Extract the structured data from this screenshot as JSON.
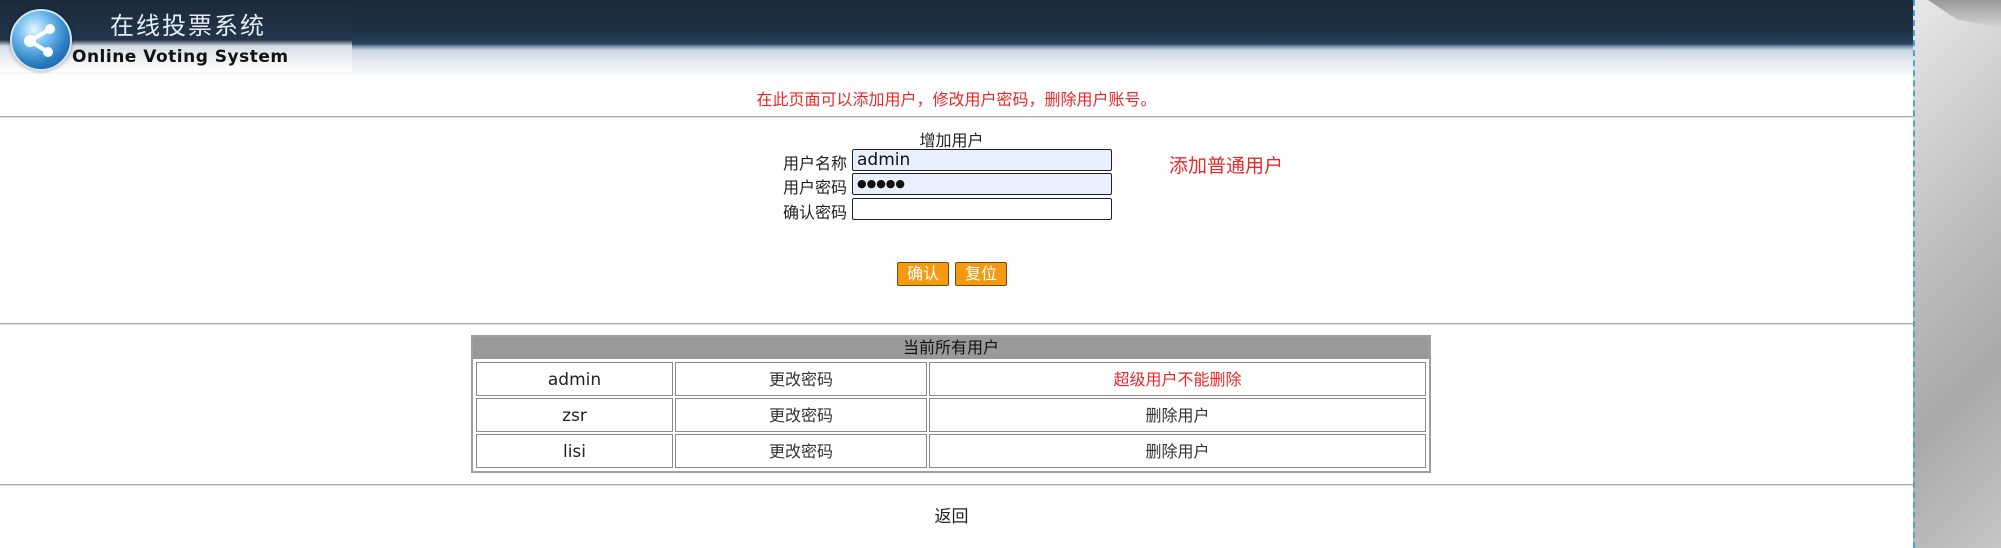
{
  "header": {
    "title_cn": "在线投票系统",
    "title_en": "Online Voting System"
  },
  "notice": "在此页面可以添加用户，修改用户密码，删除用户账号。",
  "form": {
    "title": "增加用户",
    "username_label": "用户名称",
    "username_value": "admin",
    "password_label": "用户密码",
    "password_value": "●●●●●",
    "confirm_label": "确认密码",
    "confirm_value": "",
    "hint": "添加普通用户",
    "confirm_button": "确认",
    "reset_button": "复位"
  },
  "users_table": {
    "title": "当前所有用户",
    "rows": [
      {
        "name": "admin",
        "change": "更改密码",
        "action": "超级用户不能删除",
        "action_color": "#e8282b"
      },
      {
        "name": "zsr",
        "change": "更改密码",
        "action": "删除用户"
      },
      {
        "name": "lisi",
        "change": "更改密码",
        "action": "删除用户"
      }
    ]
  },
  "back_link": "返回",
  "colors": {
    "accent_red": "#e8282b",
    "button_orange": "#f39a12",
    "header_dark": "#1b2a3a"
  }
}
